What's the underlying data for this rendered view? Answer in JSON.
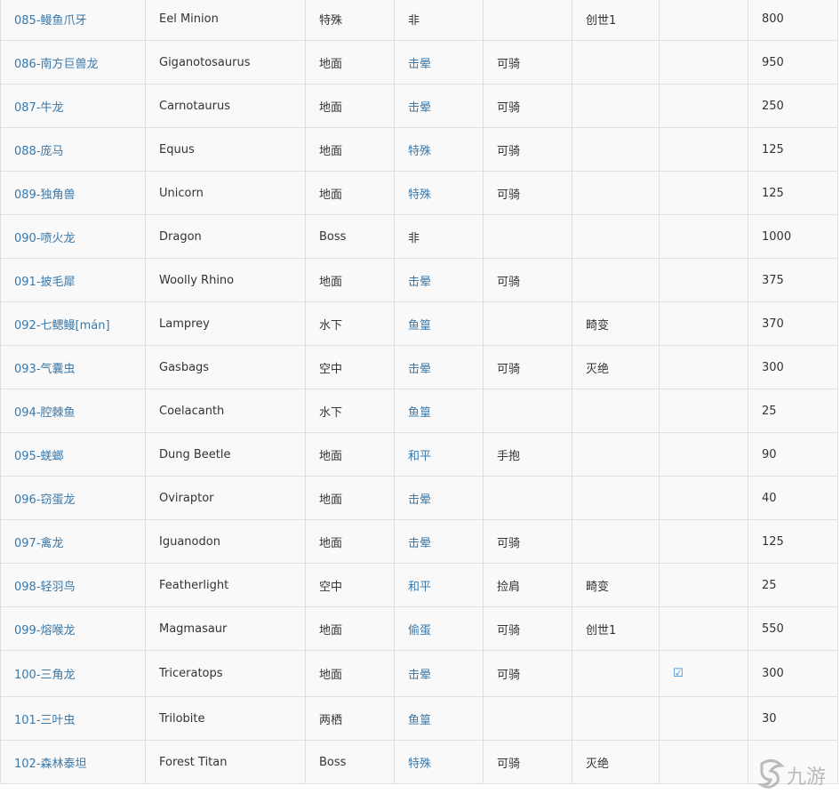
{
  "rows": [
    {
      "id": "085-鳗鱼爪牙",
      "en": "Eel Minion",
      "env": "特殊",
      "capture": "非",
      "ride": "",
      "dlc": "创世1",
      "check": "",
      "power": "800"
    },
    {
      "id": "086-南方巨兽龙",
      "en": "Giganotosaurus",
      "env": "地面",
      "capture": "击晕",
      "ride": "可骑",
      "dlc": "",
      "check": "",
      "power": "950"
    },
    {
      "id": "087-牛龙",
      "en": "Carnotaurus",
      "env": "地面",
      "capture": "击晕",
      "ride": "可骑",
      "dlc": "",
      "check": "",
      "power": "250"
    },
    {
      "id": "088-庞马",
      "en": "Equus",
      "env": "地面",
      "capture": "特殊",
      "ride": "可骑",
      "dlc": "",
      "check": "",
      "power": "125"
    },
    {
      "id": "089-独角兽",
      "en": "Unicorn",
      "env": "地面",
      "capture": "特殊",
      "ride": "可骑",
      "dlc": "",
      "check": "",
      "power": "125"
    },
    {
      "id": "090-喷火龙",
      "en": "Dragon",
      "env": "Boss",
      "capture": "非",
      "ride": "",
      "dlc": "",
      "check": "",
      "power": "1000"
    },
    {
      "id": "091-披毛犀",
      "en": "Woolly Rhino",
      "env": "地面",
      "capture": "击晕",
      "ride": "可骑",
      "dlc": "",
      "check": "",
      "power": "375"
    },
    {
      "id": "092-七鳃鳗[mán]",
      "en": "Lamprey",
      "env": "水下",
      "capture": "鱼篁",
      "ride": "",
      "dlc": "畸变",
      "check": "",
      "power": "370"
    },
    {
      "id": "093-气囊虫",
      "en": "Gasbags",
      "env": "空中",
      "capture": "击晕",
      "ride": "可骑",
      "dlc": "灭绝",
      "check": "",
      "power": "300"
    },
    {
      "id": "094-腔棘鱼",
      "en": "Coelacanth",
      "env": "水下",
      "capture": "鱼篁",
      "ride": "",
      "dlc": "",
      "check": "",
      "power": "25"
    },
    {
      "id": "095-蜣螂",
      "en": "Dung Beetle",
      "env": "地面",
      "capture": "和平",
      "ride": "手抱",
      "dlc": "",
      "check": "",
      "power": "90"
    },
    {
      "id": "096-窃蛋龙",
      "en": "Oviraptor",
      "env": "地面",
      "capture": "击晕",
      "ride": "",
      "dlc": "",
      "check": "",
      "power": "40"
    },
    {
      "id": "097-禽龙",
      "en": "Iguanodon",
      "env": "地面",
      "capture": "击晕",
      "ride": "可骑",
      "dlc": "",
      "check": "",
      "power": "125"
    },
    {
      "id": "098-轻羽鸟",
      "en": "Featherlight",
      "env": "空中",
      "capture": "和平",
      "ride": "捡肩",
      "dlc": "畸变",
      "check": "",
      "power": "25"
    },
    {
      "id": "099-熔喉龙",
      "en": "Magmasaur",
      "env": "地面",
      "capture": "偷蛋",
      "ride": "可骑",
      "dlc": "创世1",
      "check": "",
      "power": "550"
    },
    {
      "id": "100-三角龙",
      "en": "Triceratops",
      "env": "地面",
      "capture": "击晕",
      "ride": "可骑",
      "dlc": "",
      "check": "☑",
      "power": "300"
    },
    {
      "id": "101-三叶虫",
      "en": "Trilobite",
      "env": "两栖",
      "capture": "鱼篁",
      "ride": "",
      "dlc": "",
      "check": "",
      "power": "30"
    },
    {
      "id": "102-森林泰坦",
      "en": "Forest Titan",
      "env": "Boss",
      "capture": "特殊",
      "ride": "可骑",
      "dlc": "灭绝",
      "check": "",
      "power": ""
    }
  ],
  "watermark": {
    "text": "九游"
  }
}
